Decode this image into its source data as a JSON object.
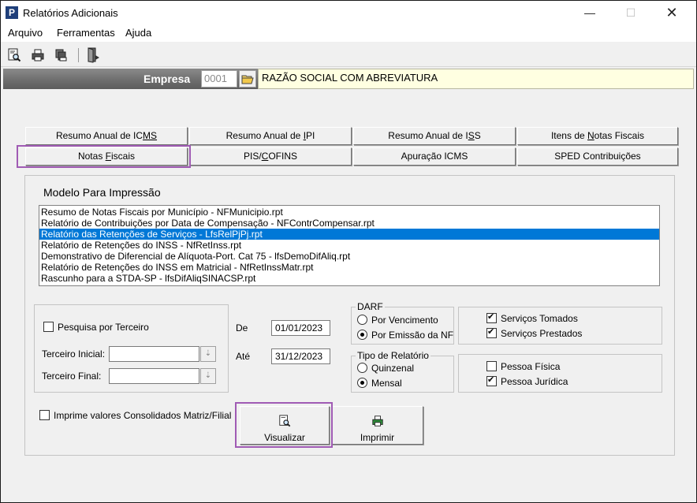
{
  "window": {
    "title": "Relatórios Adicionais",
    "min_glyph": "—",
    "max_glyph": "☐",
    "close_glyph": "✕"
  },
  "menu": {
    "items": [
      "Arquivo",
      "Ferramentas",
      "Ajuda"
    ]
  },
  "toolbar": {
    "icons": [
      "preview-icon",
      "print-icon",
      "multi-print-icon",
      "exit-door-icon"
    ]
  },
  "empresa": {
    "label": "Empresa",
    "code": "0001",
    "name": "RAZÃO SOCIAL COM ABREVIATURA"
  },
  "tabs": {
    "row1": [
      {
        "pre": "Resumo Anual de IC",
        "u": "",
        "post": "MS",
        "full": "Resumo Anual de ICMS"
      },
      {
        "pre": "Resumo Anual de ",
        "u": "I",
        "post": "PI",
        "full": "Resumo Anual de IPI"
      },
      {
        "pre": "Resumo Anual de I",
        "u": "S",
        "post": "S",
        "full": "Resumo Anual de ISS"
      },
      {
        "pre": "Itens de ",
        "u": "N",
        "post": "otas Fiscais",
        "full": "Itens de Notas Fiscais"
      }
    ],
    "row2": [
      {
        "pre": "Notas ",
        "u": "F",
        "post": "iscais",
        "full": "Notas Fiscais"
      },
      {
        "pre": "PIS/",
        "u": "C",
        "post": "OFINS",
        "full": "PIS/COFINS"
      },
      {
        "pre": "Apuração ICMS",
        "u": "",
        "post": "",
        "full": "Apuração ICMS"
      },
      {
        "pre": "SPED Contribuições",
        "u": "",
        "post": "",
        "full": "SPED Contribuições"
      }
    ],
    "active": "Notas Fiscais"
  },
  "modelo": {
    "title": "Modelo Para Impressão",
    "items": [
      "Resumo de Notas Fiscais por Município - NFMunicipio.rpt",
      "Relatório de Contribuições por Data de Compensação - NFContrCompensar.rpt",
      "Relatório das Retenções de Serviços - LfsRelPjPj.rpt",
      "Relatório de Retenções do INSS - NfRetInss.rpt",
      "Demonstrativo de Diferencial de Alíquota-Port. Cat 75 - lfsDemoDifAliq.rpt",
      "Relatório de Retenções do INSS em Matricial - NfRetInssMatr.rpt",
      "Rascunho para a STDA-SP - lfsDifAliqSINACSP.rpt"
    ],
    "selected_index": 2
  },
  "terceiro": {
    "pesquisa_label": "Pesquisa por Terceiro",
    "pesquisa_checked": false,
    "inicial_label": "Terceiro Inicial:",
    "inicial_value": "",
    "final_label": "Terceiro Final:",
    "final_value": ""
  },
  "periodo": {
    "de_label": "De",
    "de_value": "01/01/2023",
    "ate_label": "Até",
    "ate_value": "31/12/2023"
  },
  "darf": {
    "title": "DARF",
    "options": [
      "Por Vencimento",
      "Por Emissão da NF"
    ],
    "selected": "Por Emissão da NF"
  },
  "servicos": {
    "tomados_label": "Serviços Tomados",
    "tomados_checked": true,
    "prestados_label": "Serviços Prestados",
    "prestados_checked": true
  },
  "tipo_relatorio": {
    "title": "Tipo de Relatório",
    "options": [
      "Quinzenal",
      "Mensal"
    ],
    "selected": "Mensal"
  },
  "pessoa": {
    "fisica_label": "Pessoa Física",
    "fisica_checked": false,
    "juridica_label": "Pessoa Jurídica",
    "juridica_checked": true
  },
  "consolidados": {
    "label": "Imprime valores Consolidados Matriz/Filial",
    "checked": false
  },
  "actions": {
    "visualizar": "Visualizar",
    "imprimir": "Imprimir"
  },
  "colors": {
    "highlight": "#a05bb4",
    "selection": "#0078d7",
    "empresa_name_bg": "#ffffe1"
  }
}
